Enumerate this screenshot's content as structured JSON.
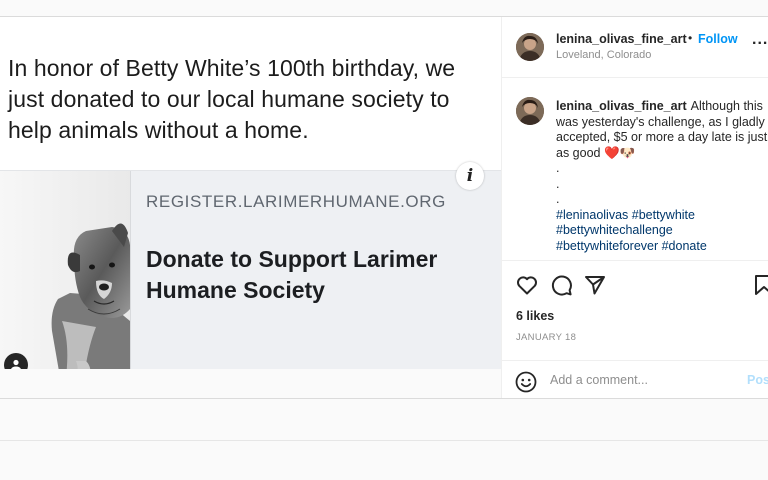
{
  "post": {
    "headline": "In honor of Betty White’s 100th birthday, we just donated to our local humane society to help animals without a home.",
    "link_card": {
      "domain": "REGISTER.LARIMERHUMANE.ORG",
      "title": "Donate to Support Larimer Humane Society"
    }
  },
  "header": {
    "username": "lenina_olivas_fine_art",
    "separator": "•",
    "follow_label": "Follow",
    "location": "Loveland, Colorado",
    "more_label": "..."
  },
  "caption": {
    "username": "lenina_olivas_fine_art",
    "text": "Although this was yesterday's challenge, as I gladly accepted, $5 or more a day late is just as good ❤️🐶",
    "dots": [
      ".",
      ".",
      "."
    ],
    "hashtags_line1": "#leninaolivas #bettywhite",
    "hashtags_line2": "#bettywhitechallenge",
    "hashtags_line3": "#bettywhiteforever #donate"
  },
  "actions": {
    "likes": "6 likes",
    "date": "JANUARY 18"
  },
  "comment": {
    "placeholder": "Add a comment...",
    "post_label": "Post"
  },
  "icons": {
    "like": "heart-icon",
    "comment": "comment-icon",
    "share": "share-icon",
    "save": "bookmark-icon",
    "emoji": "emoji-icon",
    "info": "info-icon",
    "tagged": "user-tag-icon"
  },
  "colors": {
    "link": "#0095f6",
    "hashtag": "#00376b",
    "muted": "#8e8e8e"
  }
}
